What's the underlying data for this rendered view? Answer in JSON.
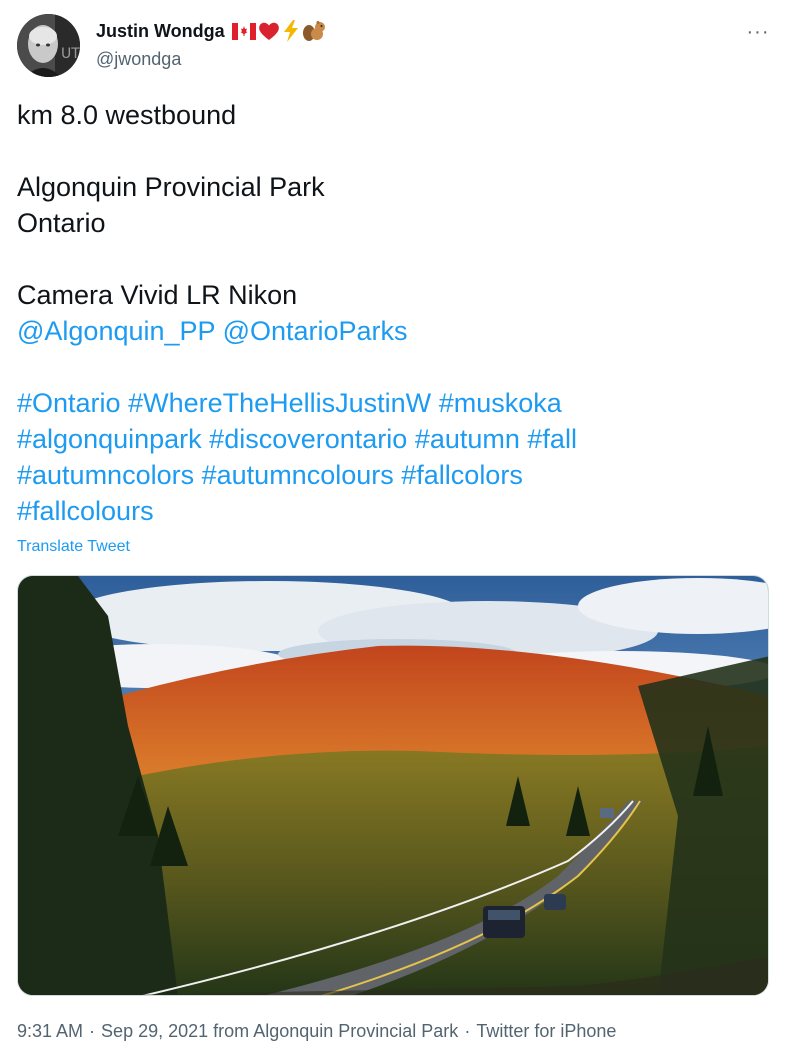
{
  "author": {
    "name": "Justin Wondga",
    "handle": "@jwondga",
    "badges": [
      "canada-flag-icon",
      "red-heart-icon",
      "lightning-icon",
      "chipmunk-icon"
    ]
  },
  "more_label": "···",
  "tweet": {
    "line1": "km 8.0 westbound",
    "line2": "Algonquin Provincial Park",
    "line3": "Ontario",
    "line4": "Camera Vivid LR Nikon",
    "mentions": [
      "@Algonquin_PP",
      "@OntarioParks"
    ],
    "hashtags_row1": [
      "#Ontario",
      "#WhereTheHellisJustinW",
      "#muskoka"
    ],
    "hashtags_row2": [
      "#algonquinpark",
      "#discoverontario",
      "#autumn",
      "#fall"
    ],
    "hashtags_row3": [
      "#autumncolors",
      "#autumncolours",
      "#fallcolors"
    ],
    "hashtags_row4": [
      "#fallcolours"
    ]
  },
  "translate_label": "Translate Tweet",
  "meta": {
    "time": "9:31 AM",
    "date": "Sep 29, 2021",
    "from_label": "from",
    "location": "Algonquin Provincial Park",
    "source": "Twitter for iPhone"
  },
  "colors": {
    "link": "#1d9bf0",
    "secondary_text": "#536471",
    "primary_text": "#0f1419"
  }
}
